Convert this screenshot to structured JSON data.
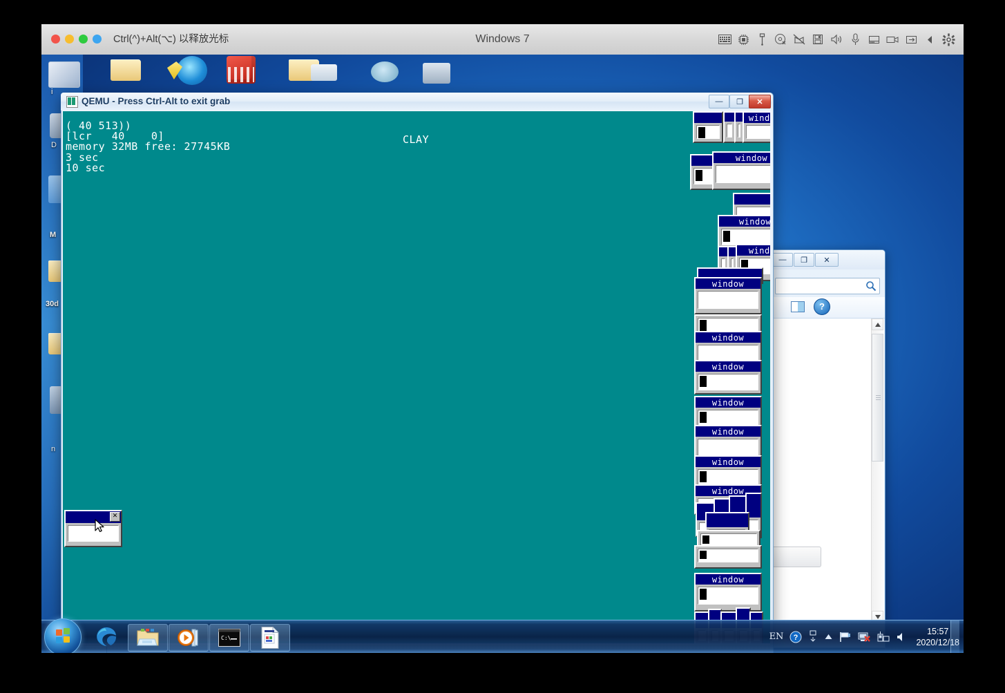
{
  "vm_window": {
    "title": "Windows 7",
    "grab_hint": "Ctrl(^)+Alt(⌥) 以释放光标",
    "traffic_lights": [
      "close",
      "minimize",
      "zoom",
      "fullscreen"
    ],
    "status_icons": [
      {
        "name": "keyboard-icon",
        "label": "Keyboard"
      },
      {
        "name": "cpu-icon",
        "label": "CPU"
      },
      {
        "name": "usb-icon",
        "label": "USB"
      },
      {
        "name": "optical-disk-icon",
        "label": "Optical Disk"
      },
      {
        "name": "network-disconnected-icon",
        "label": "Network"
      },
      {
        "name": "floppy-icon",
        "label": "Floppy"
      },
      {
        "name": "speaker-icon",
        "label": "Sound"
      },
      {
        "name": "microphone-icon",
        "label": "Microphone"
      },
      {
        "name": "harddisk-icon",
        "label": "Hard Disk"
      },
      {
        "name": "camera-icon",
        "label": "Camera"
      },
      {
        "name": "shared-folders-icon",
        "label": "Shared Folders"
      },
      {
        "name": "collapse-arrow-icon",
        "label": "Collapse"
      },
      {
        "name": "gear-icon",
        "label": "Settings"
      }
    ]
  },
  "qemu_window": {
    "title": "QEMU - Press Ctrl-Alt to exit grab",
    "minimize_label": "—",
    "maximize_label": "❐",
    "close_label": "✕",
    "console_text": "( 40 513))\n[lcr   40    0]\nmemory 32MB free: 27745KB\n3 sec\n10 sec",
    "clay_text": "CLAY",
    "screen_bg": "#00898c"
  },
  "guest_windows": {
    "default_title": "window",
    "cursor_window_title": "",
    "close_glyph": "✕"
  },
  "explorer_window": {
    "minimize_label": "—",
    "maximize_label": "❐",
    "close_label": "✕",
    "search_placeholder": "",
    "help_label": "?"
  },
  "desktop": {
    "icon_labels": [
      "i",
      "D",
      "M",
      "30d",
      "n"
    ]
  },
  "taskbar": {
    "start_label": "Start",
    "items": [
      {
        "name": "taskbar-edge",
        "label": "Microsoft Edge"
      },
      {
        "name": "taskbar-explorer",
        "label": "Windows Explorer"
      },
      {
        "name": "taskbar-media-player",
        "label": "Windows Media Player"
      },
      {
        "name": "taskbar-command-prompt",
        "label": "Command Prompt"
      },
      {
        "name": "taskbar-document",
        "label": "Document"
      }
    ],
    "tray": {
      "ime_language": "EN",
      "help_label": "?",
      "icons": [
        {
          "name": "ime-toggle-icon",
          "label": "IME"
        },
        {
          "name": "show-hidden-icons-icon",
          "label": "Show hidden icons"
        },
        {
          "name": "action-center-flag-icon",
          "label": "Action Center"
        },
        {
          "name": "network-disconnected-icon",
          "label": "Network not connected"
        },
        {
          "name": "device-icon",
          "label": "Device"
        },
        {
          "name": "volume-icon",
          "label": "Volume"
        }
      ],
      "time": "15:57",
      "date": "2020/12/18"
    }
  },
  "colors": {
    "guest_teal": "#00898c",
    "retro_titlebar": "#000080",
    "retro_face": "#c0c0c0",
    "win7_desktop": "#1f6fc4",
    "qemu_close_red": "#c0392b"
  }
}
